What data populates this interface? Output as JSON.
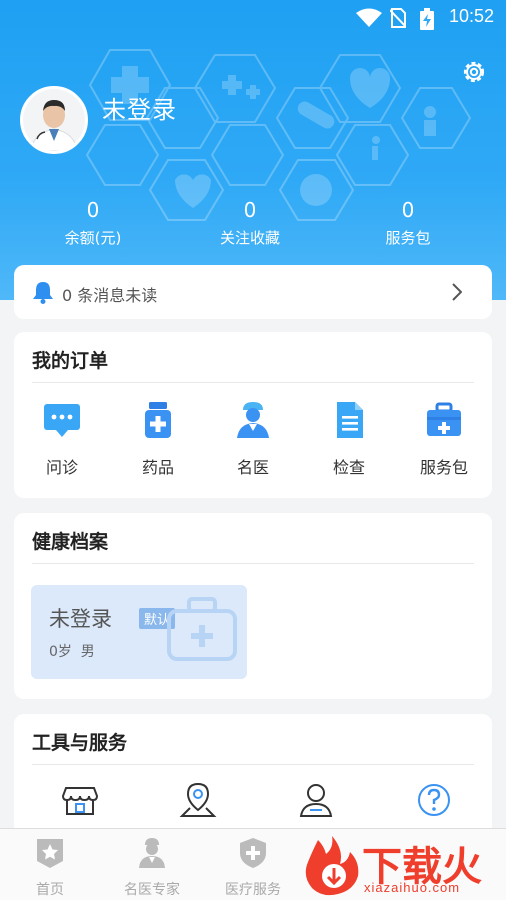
{
  "status_bar": {
    "time": "10:52"
  },
  "header": {
    "username": "未登录",
    "stats": [
      {
        "value": "0",
        "label": "余额(元)"
      },
      {
        "value": "0",
        "label": "关注收藏"
      },
      {
        "value": "0",
        "label": "服务包"
      }
    ]
  },
  "notice": {
    "text": "0 条消息未读"
  },
  "orders": {
    "title": "我的订单",
    "items": [
      {
        "label": "问诊",
        "icon": "chat-icon"
      },
      {
        "label": "药品",
        "icon": "medicine-bottle-icon"
      },
      {
        "label": "名医",
        "icon": "doctor-icon"
      },
      {
        "label": "检查",
        "icon": "document-icon"
      },
      {
        "label": "服务包",
        "icon": "medkit-icon"
      }
    ]
  },
  "health": {
    "title": "健康档案",
    "profile": {
      "name": "未登录",
      "badge": "默认",
      "info": "0岁  男"
    }
  },
  "tools": {
    "title": "工具与服务",
    "items": [
      "store-icon",
      "location-icon",
      "person-icon",
      "help-icon"
    ]
  },
  "bottom_nav": [
    {
      "label": "首页",
      "icon": "home-star-icon"
    },
    {
      "label": "名医专家",
      "icon": "doctor-icon"
    },
    {
      "label": "医疗服务",
      "icon": "shield-plus-icon"
    }
  ],
  "watermark": {
    "text": "下载火",
    "url": "xiazaihuo.com"
  },
  "colors": {
    "primary": "#1fa0f2",
    "icon_blue": "#3a9af5",
    "watermark": "#ef3e2c"
  }
}
